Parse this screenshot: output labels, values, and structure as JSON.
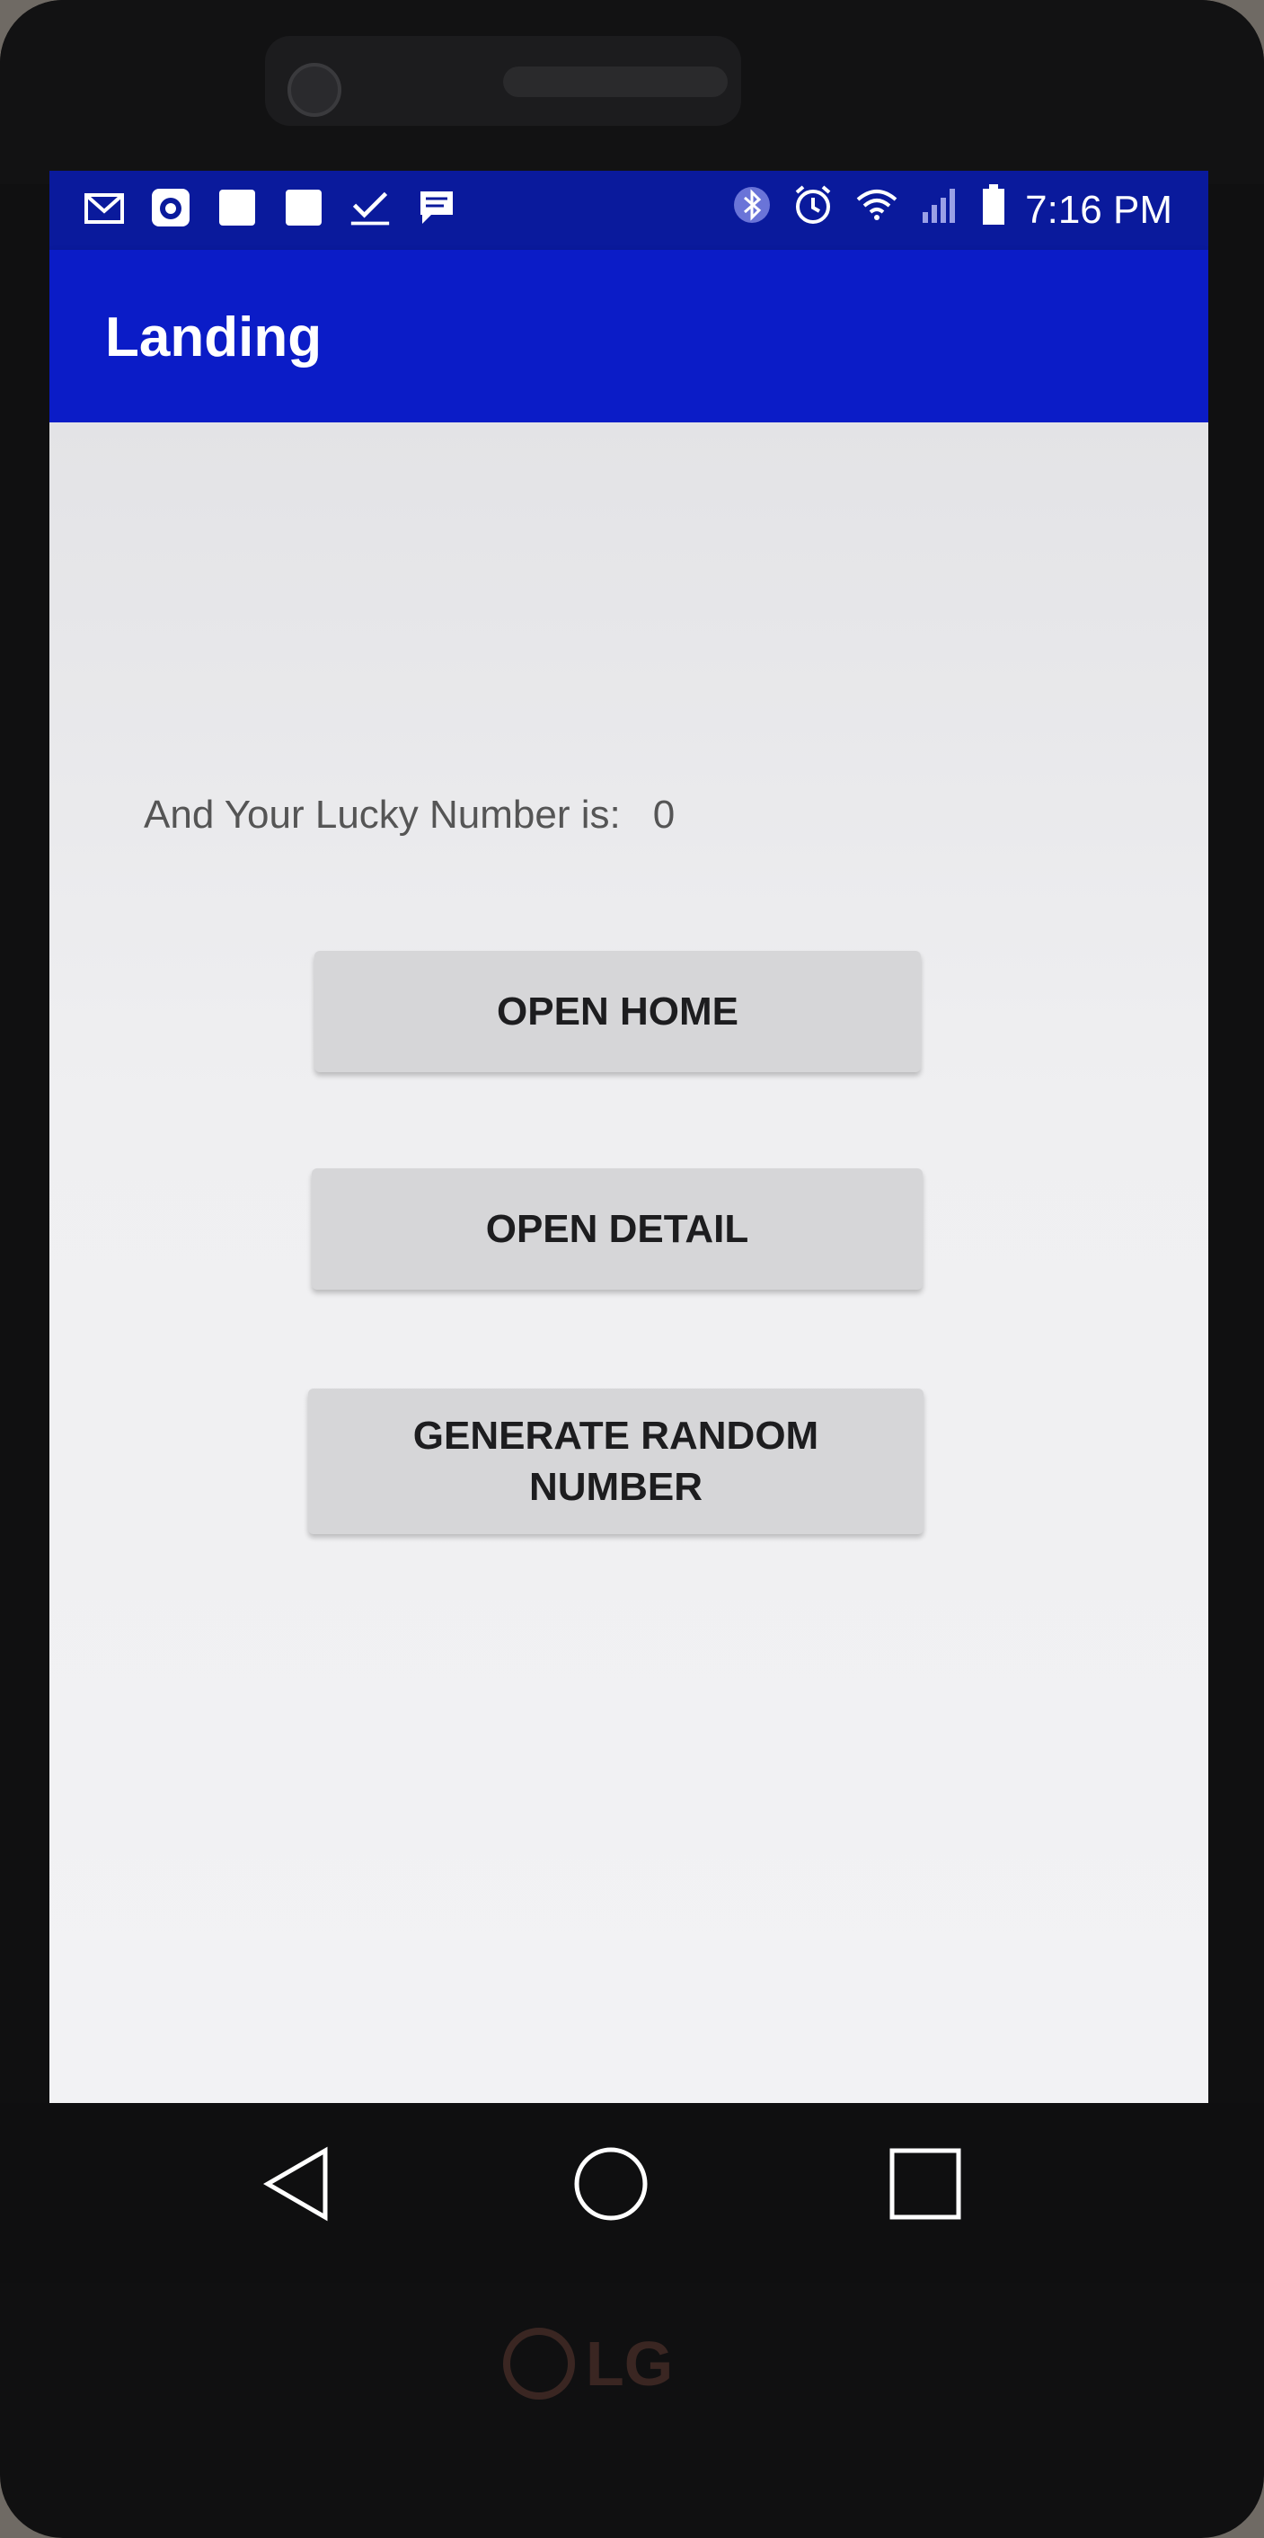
{
  "status_bar": {
    "time": "7:16 PM",
    "left_icons": [
      "gmail-icon",
      "camera-notification-icon",
      "square-notification-icon",
      "square-notification-icon",
      "checkmark-notification-icon",
      "message-icon"
    ],
    "right_icons": [
      "bluetooth-icon",
      "alarm-icon",
      "wifi-icon",
      "signal-icon",
      "battery-icon"
    ]
  },
  "app_bar": {
    "title": "Landing",
    "color": "#0b1cc7"
  },
  "main": {
    "lucky_label": "And Your Lucky Number is:",
    "lucky_value": "0",
    "buttons": {
      "open_home": "OPEN HOME",
      "open_detail": "OPEN DETAIL",
      "generate_random": "GENERATE RANDOM NUMBER"
    }
  },
  "nav_bar": {
    "items": [
      "back-icon",
      "home-icon",
      "recents-icon"
    ]
  },
  "device": {
    "brand": "LG"
  }
}
